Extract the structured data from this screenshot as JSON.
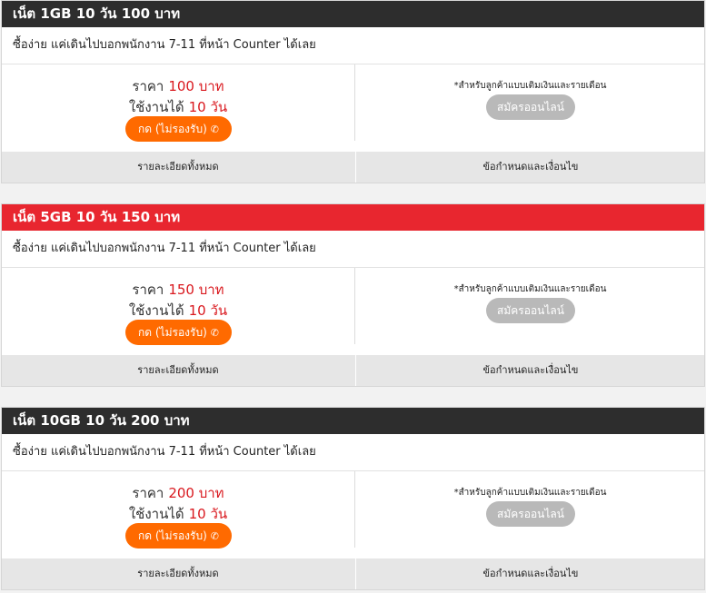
{
  "plans": [
    {
      "title": "เน็ต 1GB 10 วัน 100 บาท",
      "header_color": "#2d2d2d",
      "description": "ซื้อง่าย แค่เดินไปบอกพนักงาน 7-11 ที่หน้า Counter ได้เลย",
      "price_label": "ราคา",
      "price_value": "100 บาท",
      "days_label": "ใช้งานได้",
      "days_value": "10 วัน",
      "dial_button": "กด (ไม่รองรับ)",
      "note": "*สำหรับลูกค้าแบบเติมเงินและรายเดือน",
      "apply_button": "สมัครออนไลน์",
      "details_link": "รายละเอียดทั้งหมด",
      "terms_link": "ข้อกำหนดและเงื่อนไข"
    },
    {
      "title": "เน็ต 5GB 10 วัน 150 บาท",
      "header_color": "#e8262f",
      "description": "ซื้อง่าย แค่เดินไปบอกพนักงาน 7-11 ที่หน้า Counter ได้เลย",
      "price_label": "ราคา",
      "price_value": "150 บาท",
      "days_label": "ใช้งานได้",
      "days_value": "10 วัน",
      "dial_button": "กด (ไม่รองรับ)",
      "note": "*สำหรับลูกค้าแบบเติมเงินและรายเดือน",
      "apply_button": "สมัครออนไลน์",
      "details_link": "รายละเอียดทั้งหมด",
      "terms_link": "ข้อกำหนดและเงื่อนไข"
    },
    {
      "title": "เน็ต 10GB 10 วัน 200 บาท",
      "header_color": "#2d2d2d",
      "description": "ซื้อง่าย แค่เดินไปบอกพนักงาน 7-11 ที่หน้า Counter ได้เลย",
      "price_label": "ราคา",
      "price_value": "200 บาท",
      "days_label": "ใช้งานได้",
      "days_value": "10 วัน",
      "dial_button": "กด (ไม่รองรับ)",
      "note": "*สำหรับลูกค้าแบบเติมเงินและรายเดือน",
      "apply_button": "สมัครออนไลน์",
      "details_link": "รายละเอียดทั้งหมด",
      "terms_link": "ข้อกำหนดและเงื่อนไข"
    }
  ],
  "colors": {
    "dial_button": "#ff6a00",
    "price_highlight": "#d9181e",
    "apply_button_disabled": "#b9b9b9"
  },
  "icons": {
    "dial": "phone-icon"
  }
}
